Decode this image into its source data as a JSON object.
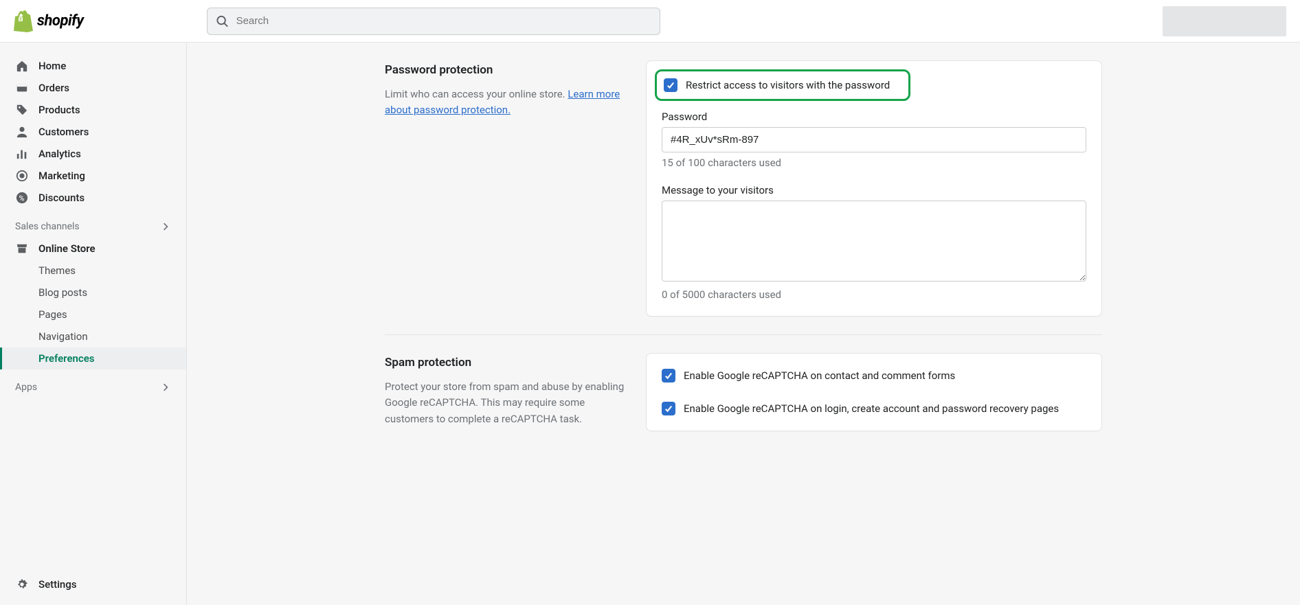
{
  "header": {
    "brand": "shopify",
    "search_placeholder": "Search"
  },
  "sidebar": {
    "main": [
      {
        "label": "Home"
      },
      {
        "label": "Orders"
      },
      {
        "label": "Products"
      },
      {
        "label": "Customers"
      },
      {
        "label": "Analytics"
      },
      {
        "label": "Marketing"
      },
      {
        "label": "Discounts"
      }
    ],
    "channels_heading": "Sales channels",
    "channel": "Online Store",
    "channel_sub": [
      {
        "label": "Themes"
      },
      {
        "label": "Blog posts"
      },
      {
        "label": "Pages"
      },
      {
        "label": "Navigation"
      },
      {
        "label": "Preferences"
      }
    ],
    "apps_heading": "Apps",
    "settings": "Settings"
  },
  "password_section": {
    "title": "Password protection",
    "desc_lead": "Limit who can access your online store. ",
    "link": "Learn more about password protection.",
    "checkbox_label": "Restrict access to visitors with the password",
    "password_label": "Password",
    "password_value": "#4R_xUv*sRm-897",
    "password_counter": "15 of 100 characters used",
    "message_label": "Message to your visitors",
    "message_counter": "0 of 5000 characters used"
  },
  "spam_section": {
    "title": "Spam protection",
    "desc": "Protect your store from spam and abuse by enabling Google reCAPTCHA. This may require some customers to complete a reCAPTCHA task.",
    "check1": "Enable Google reCAPTCHA on contact and comment forms",
    "check2": "Enable Google reCAPTCHA on login, create account and password recovery pages"
  }
}
